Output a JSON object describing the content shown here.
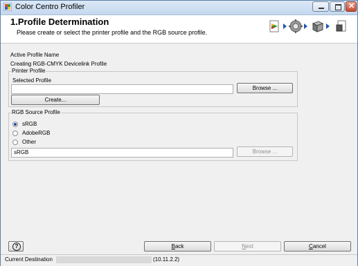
{
  "window": {
    "title": "Color Centro Profiler"
  },
  "header": {
    "title": "1.Profile Determination",
    "subtitle": "Please create or select the printer profile and the RGB source profile."
  },
  "active_profile": {
    "label": "Active Profile Name",
    "value": "Creating RGB-CMYK Devicelink Profile"
  },
  "printer_profile": {
    "group_title": "Printer Profile",
    "selected_label": "Selected Profile",
    "selected_value": "",
    "browse_label": "Browse ...",
    "create_label": "Create..."
  },
  "rgb_source": {
    "group_title": "RGB Source Profile",
    "options": [
      "sRGB",
      "AdobeRGB",
      "Other"
    ],
    "selected": "sRGB",
    "field_value": "sRGB",
    "browse_label": "Browse ..."
  },
  "footer": {
    "back_prefix": "",
    "back_u": "B",
    "back_rest": "ack",
    "next_u": "N",
    "next_rest": "ext",
    "cancel_u": "C",
    "cancel_rest": "ancel",
    "help_symbol": "?"
  },
  "status": {
    "label": "Current Destination",
    "value": "(10.11.2.2)"
  },
  "icons": [
    "app-icon",
    "minimize-icon",
    "maximize-icon",
    "close-icon",
    "profile-start-icon",
    "settings-gear-icon",
    "printer-box-icon",
    "document-finish-icon",
    "help-icon"
  ],
  "colors": {
    "accent": "#1f56b5",
    "titlebar": "#c5d8ee",
    "close": "#c34b2f"
  }
}
